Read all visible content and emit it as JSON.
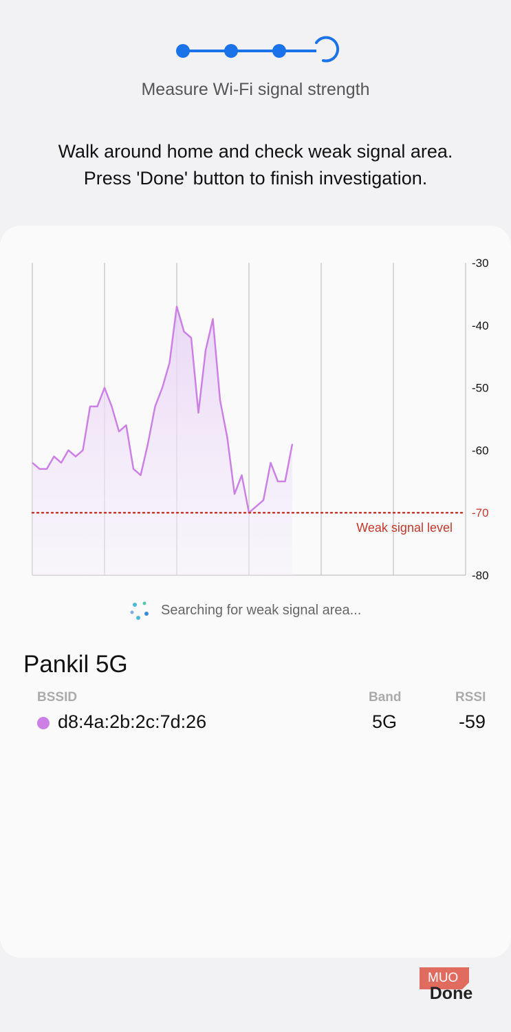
{
  "header": {
    "subtitle": "Measure Wi-Fi signal strength",
    "instructions_line1": "Walk around home and check weak signal area.",
    "instructions_line2": "Press 'Done' button to finish investigation.",
    "steps_total": 4,
    "steps_completed": 3
  },
  "chart_data": {
    "type": "area",
    "y_ticks": [
      "-30",
      "-40",
      "-50",
      "-60",
      "-70",
      "-80"
    ],
    "ylim": [
      -80,
      -30
    ],
    "threshold": {
      "value": -70,
      "label": "Weak signal level"
    },
    "series": [
      {
        "values": [
          -62,
          -63,
          -63,
          -61,
          -62,
          -60,
          -61,
          -60,
          -53,
          -53,
          -50,
          -53,
          -57,
          -56,
          -63,
          -64,
          -59,
          -53,
          -50,
          -46,
          -37,
          -41,
          -42,
          -54,
          -44,
          -39,
          -52,
          -58,
          -67,
          -64,
          -70,
          -69,
          -68,
          -62,
          -65,
          -65,
          -59
        ]
      }
    ],
    "colors": {
      "line": "#cc80e6",
      "fill": "#efe3f8",
      "threshold": "#c0392b",
      "grid": "#b5b5b5"
    }
  },
  "status": {
    "searching_text": "Searching for weak signal area..."
  },
  "network": {
    "name": "Pankil 5G",
    "columns": {
      "bssid": "BSSID",
      "band": "Band",
      "rssi": "RSSI"
    },
    "rows": [
      {
        "bssid": "d8:4a:2b:2c:7d:26",
        "band": "5G",
        "rssi": "-59",
        "color": "#cc80e6"
      }
    ]
  },
  "footer": {
    "done_label": "Done",
    "watermark": "MUO"
  },
  "colors": {
    "accent": "#1a73e8",
    "background": "#f2f2f4",
    "card": "#fafafb"
  }
}
